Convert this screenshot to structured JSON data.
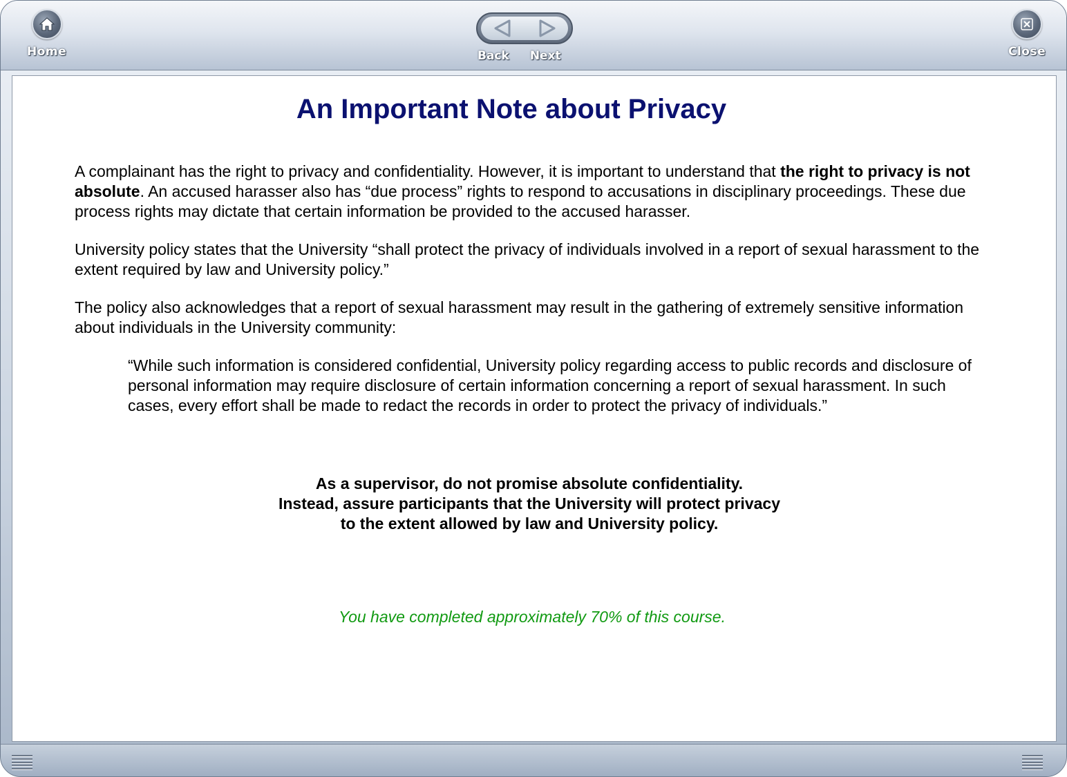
{
  "toolbar": {
    "home_label": "Home",
    "back_label": "Back",
    "next_label": "Next",
    "close_label": "Close"
  },
  "page": {
    "title": "An Important Note about Privacy",
    "para1_start": "A complainant has the right to privacy and confidentiality. However, it is important to understand that ",
    "para1_bold": "the right to privacy is not absolute",
    "para1_end": ". An accused harasser also has “due process” rights to respond to accusations in disciplinary proceedings. These due process rights may dictate that certain information be provided to the accused harasser.",
    "para2": "University policy states that the University “shall protect the privacy of individuals involved in a report of sexual harassment to the extent required by law and University policy.”",
    "para3": "The policy also acknowledges that a report of sexual harassment may result in the gathering of extremely sensitive information about individuals in the University community:",
    "quote": "“While such information is considered confidential, University policy regarding access to public records and disclosure of personal information may require disclosure of certain information concerning a report of sexual harassment. In such cases, every effort shall be made to redact the records in order to protect the privacy of individuals.”",
    "emphasis_line1": "As a supervisor, do not promise absolute confidentiality.",
    "emphasis_line2": "Instead, assure participants that the University will protect privacy",
    "emphasis_line3": "to the extent allowed by law and University policy.",
    "progress_text": "You have completed approximately 70% of this course."
  },
  "icons": {
    "home": "home-icon",
    "back": "left-arrow-icon",
    "next": "right-arrow-icon",
    "close": "close-icon",
    "grip": "resize-grip-icon"
  },
  "colors": {
    "title": "#0b1170",
    "progress": "#119a12",
    "chrome": "#b7c3d4"
  }
}
